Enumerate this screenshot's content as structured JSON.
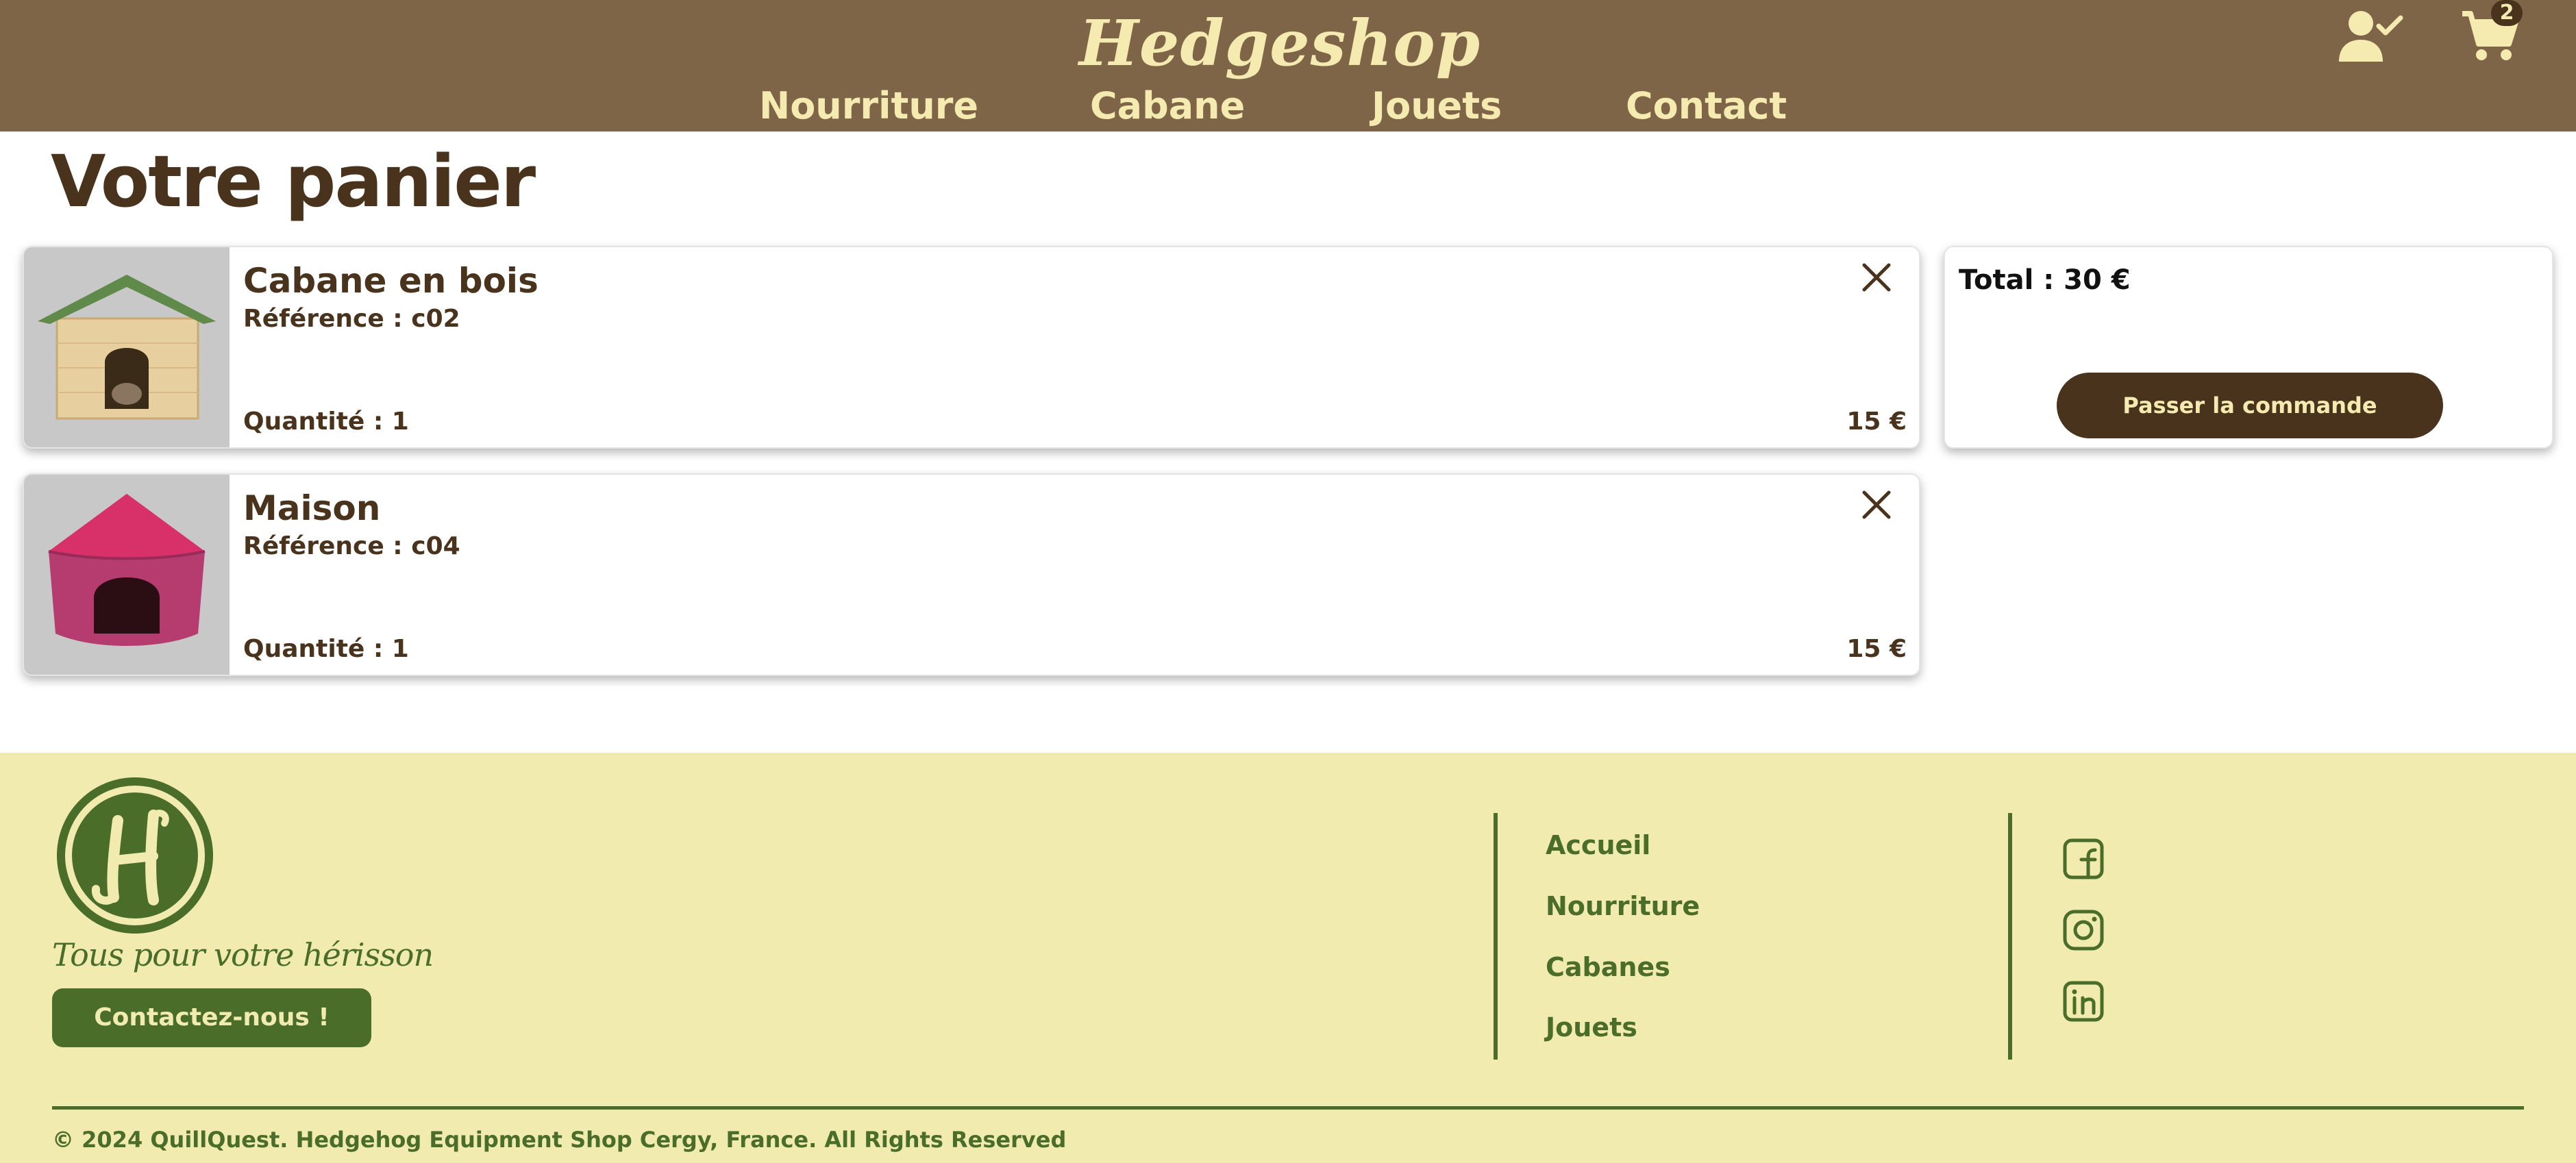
{
  "header": {
    "logo_text": "Hedgeshop",
    "nav": [
      "Nourriture",
      "Cabane",
      "Jouets",
      "Contact"
    ],
    "cart_count": "2",
    "icons": {
      "account": "user-check-icon",
      "cart": "shopping-cart-icon"
    }
  },
  "main": {
    "title": "Votre panier",
    "items": [
      {
        "name": "Cabane en bois",
        "reference": "Référence : c02",
        "quantity": "Quantité : 1",
        "price": "15 €",
        "image": "wooden-hedgehog-house-image"
      },
      {
        "name": "Maison",
        "reference": "Référence : c04",
        "quantity": "Quantité : 1",
        "price": "15 €",
        "image": "pink-fabric-house-image"
      }
    ],
    "summary": {
      "total": "Total : 30 €",
      "order_button": "Passer la commande"
    }
  },
  "footer": {
    "tagline": "Tous pour votre hérisson",
    "contact_button": "Contactez-nous !",
    "links": [
      "Accueil",
      "Nourriture",
      "Cabanes",
      "Jouets"
    ],
    "social": [
      "facebook-icon",
      "instagram-icon",
      "linkedin-icon"
    ],
    "copyright": "© 2024 QuillQuest. Hedgehog Equipment Shop Cergy, France. All Rights Reserved"
  },
  "colors": {
    "header_bg": "#7f6548",
    "header_text": "#f5eab0",
    "dark_brown": "#4a331d",
    "footer_bg": "#f2ebb0",
    "footer_green": "#4a6e2a"
  }
}
